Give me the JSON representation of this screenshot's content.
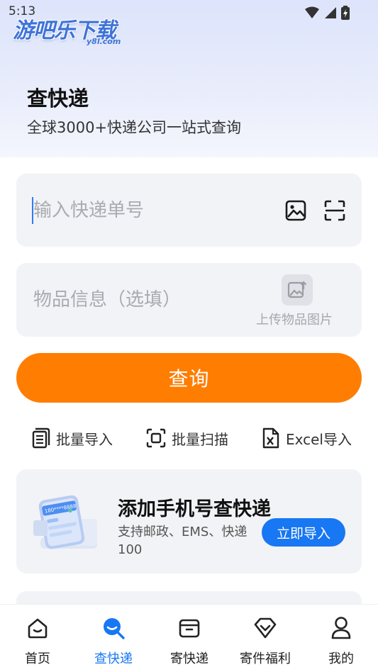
{
  "status_bar": {
    "time": "5:13"
  },
  "logo": {
    "text": "游吧乐下载",
    "sub": "y8l.com"
  },
  "header": {
    "title": "查快递",
    "subtitle": "全球3000+快递公司一站式查询"
  },
  "tracking": {
    "placeholder": "输入快递单号",
    "value": ""
  },
  "item_info": {
    "placeholder": "物品信息（选填）",
    "upload_label": "上传物品图片"
  },
  "query_button": {
    "label": "查询"
  },
  "tools": [
    {
      "label": "批量导入",
      "icon": "document-list-icon"
    },
    {
      "label": "批量扫描",
      "icon": "scan-frame-icon"
    },
    {
      "label": "Excel导入",
      "icon": "excel-icon"
    }
  ],
  "promo": {
    "title": "添加手机号查快递",
    "description": "支持邮政、EMS、快递100",
    "button": "立即导入",
    "phone_masked": "180****8888"
  },
  "tabbar": {
    "items": [
      {
        "label": "首页",
        "icon": "home-icon",
        "active": false
      },
      {
        "label": "查快递",
        "icon": "search-icon",
        "active": true
      },
      {
        "label": "寄快递",
        "icon": "package-icon",
        "active": false
      },
      {
        "label": "寄件福利",
        "icon": "diamond-icon",
        "active": false
      },
      {
        "label": "我的",
        "icon": "user-icon",
        "active": false
      }
    ]
  },
  "colors": {
    "accent": "#ff7d00",
    "primary": "#1877f2",
    "card_bg": "#f2f3f6"
  }
}
